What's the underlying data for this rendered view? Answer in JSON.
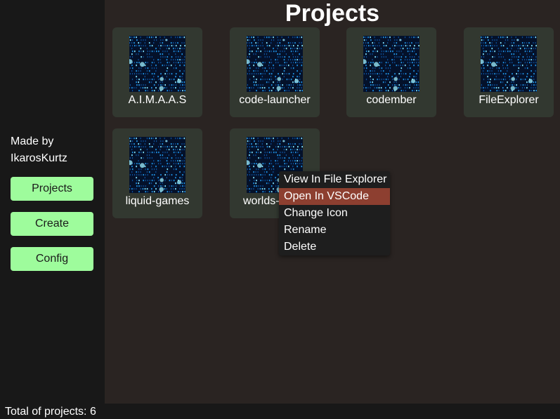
{
  "page": {
    "title": "Projects"
  },
  "sidebar": {
    "made_by_line1": "Made by",
    "made_by_line2": "IkarosKurtz",
    "buttons": {
      "projects": "Projects",
      "create": "Create",
      "config": "Config"
    }
  },
  "projects": [
    {
      "name": "A.I.M.A.A.S",
      "icon": "binary-code-thumbnail"
    },
    {
      "name": "code-launcher",
      "icon": "binary-code-thumbnail"
    },
    {
      "name": "codember",
      "icon": "binary-code-thumbnail"
    },
    {
      "name": "FileExplorer",
      "icon": "binary-code-thumbnail"
    },
    {
      "name": "liquid-games",
      "icon": "binary-code-thumbnail"
    },
    {
      "name": "worlds-",
      "icon": "binary-code-thumbnail"
    }
  ],
  "context_menu": {
    "items": [
      "View In File Explorer",
      "Open In VSCode",
      "Change Icon",
      "Rename",
      "Delete"
    ],
    "highlighted": "Open In VSCode"
  },
  "footer": {
    "total_text": "Total of projects: 6"
  },
  "colors": {
    "sidebar_bg": "#181818",
    "main_bg": "#2a2422",
    "card_bg": "#323830",
    "button_bg": "#9efc9c",
    "menu_bg": "#1e1e1e",
    "menu_highlight": "#8d3f30"
  }
}
